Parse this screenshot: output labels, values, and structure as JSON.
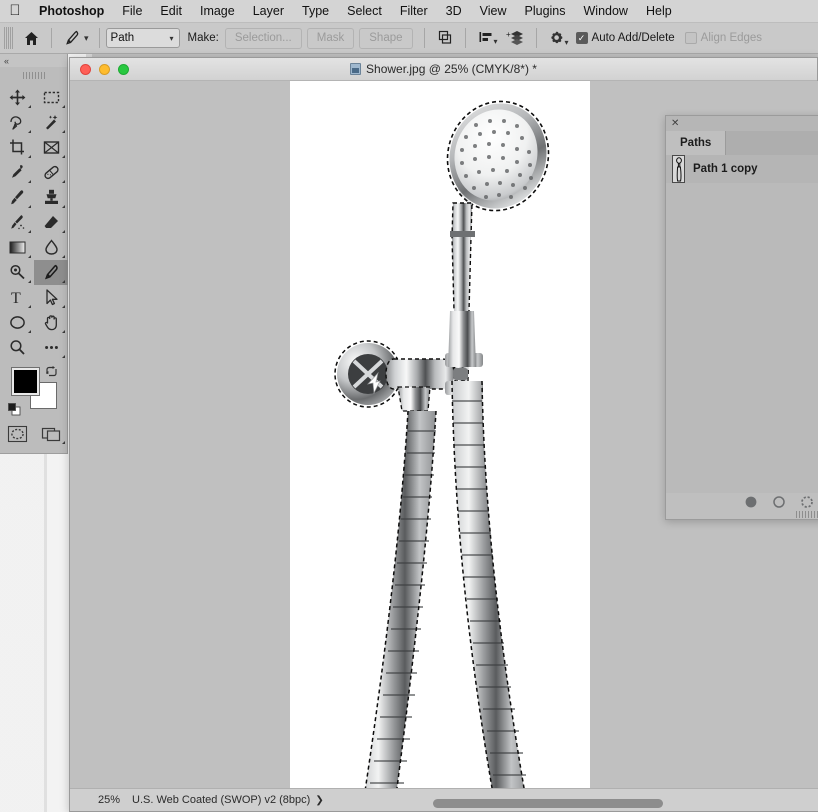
{
  "menubar": {
    "apple_icon": "apple-logo-icon",
    "items": [
      {
        "label": "Photoshop",
        "bold": true
      },
      {
        "label": "File"
      },
      {
        "label": "Edit"
      },
      {
        "label": "Image"
      },
      {
        "label": "Layer"
      },
      {
        "label": "Type"
      },
      {
        "label": "Select"
      },
      {
        "label": "Filter"
      },
      {
        "label": "3D"
      },
      {
        "label": "View"
      },
      {
        "label": "Plugins"
      },
      {
        "label": "Window"
      },
      {
        "label": "Help"
      }
    ]
  },
  "options_bar": {
    "home_icon": "home-icon",
    "tool_icon": "pen-tool-icon",
    "tool_caret": "chevron-down-icon",
    "mode_select": {
      "value": "Path",
      "caret": "chevron-down-icon"
    },
    "make_label": "Make:",
    "buttons": [
      {
        "label": "Selection...",
        "enabled": false
      },
      {
        "label": "Mask",
        "enabled": false
      },
      {
        "label": "Shape",
        "enabled": false
      }
    ],
    "path_operations_icon": "path-operations-icon",
    "path_alignment_icon": "path-alignment-icon",
    "path_arrangement_icon": "path-arrangement-icon",
    "gear_icon": "gear-icon",
    "auto_add_delete": {
      "label": "Auto Add/Delete",
      "checked": true
    },
    "align_edges": {
      "label": "Align Edges",
      "checked": false,
      "enabled": false
    }
  },
  "tools": {
    "collapse_icon": "collapse-double-chevron-left-icon",
    "grip_icon": "panel-grip-icon",
    "items": [
      {
        "name": "move-tool",
        "icon": "move-arrows-icon"
      },
      {
        "name": "rectangular-marquee-tool",
        "icon": "marquee-dashed-rect-icon"
      },
      {
        "name": "lasso-tool",
        "icon": "lasso-icon"
      },
      {
        "name": "object-selection-tool",
        "icon": "magic-wand-icon"
      },
      {
        "name": "crop-tool",
        "icon": "crop-icon"
      },
      {
        "name": "frame-tool",
        "icon": "frame-icon"
      },
      {
        "name": "eyedropper-tool",
        "icon": "eyedropper-icon"
      },
      {
        "name": "spot-healing-brush-tool",
        "icon": "healing-bandage-icon"
      },
      {
        "name": "brush-tool",
        "icon": "brush-icon"
      },
      {
        "name": "clone-stamp-tool",
        "icon": "clone-stamp-icon"
      },
      {
        "name": "history-brush-tool",
        "icon": "history-brush-icon"
      },
      {
        "name": "eraser-tool",
        "icon": "eraser-icon"
      },
      {
        "name": "gradient-tool",
        "icon": "gradient-icon"
      },
      {
        "name": "blur-tool",
        "icon": "water-drop-icon"
      },
      {
        "name": "dodge-tool",
        "icon": "dodge-icon"
      },
      {
        "name": "pen-tool",
        "icon": "pen-nib-icon",
        "selected": true
      },
      {
        "name": "type-tool",
        "icon": "type-t-icon"
      },
      {
        "name": "path-selection-tool",
        "icon": "path-arrow-icon"
      },
      {
        "name": "ellipse-tool",
        "icon": "ellipse-icon"
      },
      {
        "name": "hand-tool",
        "icon": "hand-icon"
      },
      {
        "name": "zoom-tool",
        "icon": "magnifier-icon"
      },
      {
        "name": "edit-toolbar",
        "icon": "ellipsis-icon"
      }
    ],
    "foreground_color": "#000000",
    "background_color": "#ffffff",
    "swap_colors_icon": "swap-colors-arrows-icon",
    "default_colors_icon": "default-colors-icon",
    "quick_mask_icon": "quick-mask-icon",
    "screen_mode_icon": "screen-mode-icon"
  },
  "document": {
    "title": "Shower.jpg @ 25% (CMYK/8*) *",
    "file_icon": "image-document-icon",
    "traffic_lights": {
      "close": "close-window-button",
      "minimize": "minimize-window-button",
      "zoom": "maximize-window-button"
    },
    "status": {
      "zoom": "25%",
      "color_profile": "U.S. Web Coated (SWOP) v2 (8bpc)",
      "chevron": "❯"
    },
    "artwork_alt": "chrome handheld shower head with two flexible hoses on white background, path outline selected"
  },
  "paths_panel": {
    "close_icon": "close-panel-icon",
    "tab_label": "Paths",
    "rows": [
      {
        "label": "Path 1 copy",
        "thumbnail": "path-thumbnail"
      }
    ],
    "footer_icons": [
      {
        "name": "fill-path-with-foreground-color-icon",
        "glyph": "filled-circle"
      },
      {
        "name": "stroke-path-with-brush-icon",
        "glyph": "hollow-circle"
      },
      {
        "name": "load-path-as-selection-icon",
        "glyph": "dashed-circle"
      }
    ],
    "resize_grip_icon": "panel-resize-grip-icon"
  },
  "colors": {
    "menubar_bg": "#d4d4d4",
    "options_bar_bg": "#c9c9c9",
    "panel_bg": "#bfbfbf",
    "canvas_bg": "#c0c0c0",
    "paper": "#ffffff",
    "selected_tool_bg": "#8e8e8e"
  }
}
